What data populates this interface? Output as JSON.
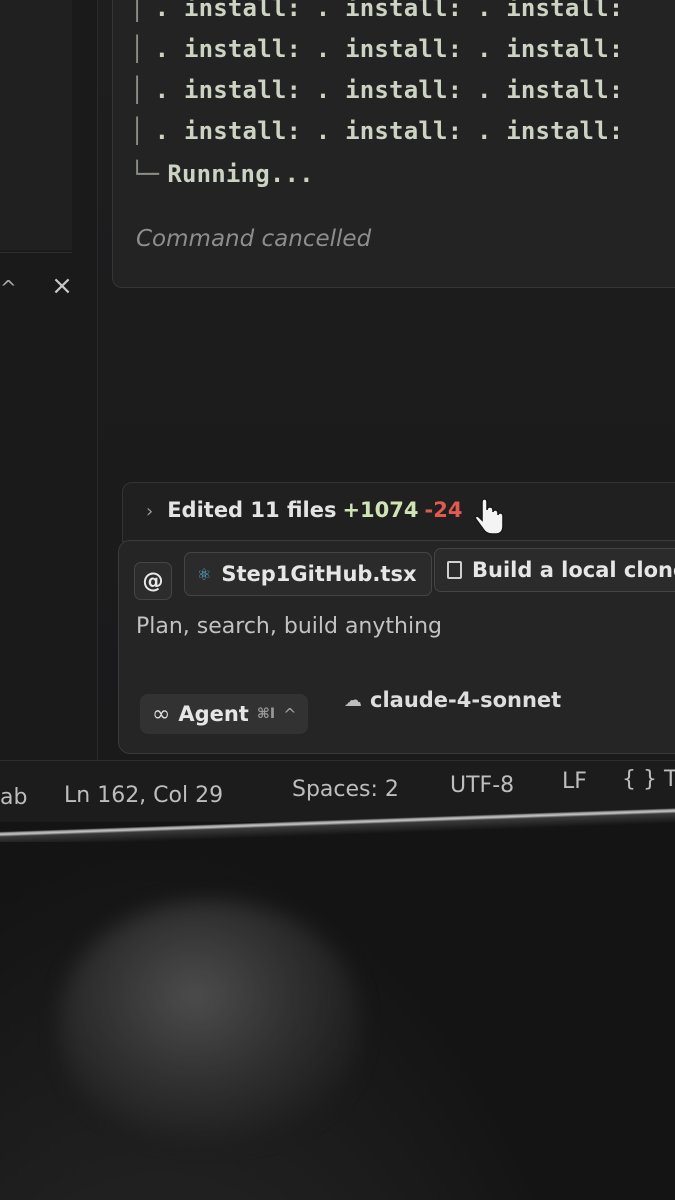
{
  "terminal": {
    "install_lines": [
      ". install: . install: . install:",
      ". install: . install: . install:",
      ". install: . install: . install:",
      ". install: . install: . install:"
    ],
    "running": "Running...",
    "status": "Command cancelled"
  },
  "panel": {
    "close_icon": "×",
    "caret_icon": "^"
  },
  "edits": {
    "label": "Edited 11 files",
    "added": "+1074",
    "removed": "-24"
  },
  "composer": {
    "mention_label": "@",
    "context_file": "Step1GitHub.tsx",
    "context_doc": "Build a local clone",
    "placeholder": "Plan, search, build anything",
    "mode_label": "Agent",
    "mode_shortcut": "⌘I",
    "model_label": "claude-4-sonnet"
  },
  "status_bar": {
    "indent_partial": "ab",
    "cursor_position": "Ln 162, Col 29",
    "spaces": "Spaces: 2",
    "encoding": "UTF-8",
    "line_ending": "LF",
    "language_partial": "{ }  T"
  },
  "colors": {
    "added": "#cfe3b5",
    "removed": "#e05a4f",
    "react_icon": "#5fb3d8"
  }
}
